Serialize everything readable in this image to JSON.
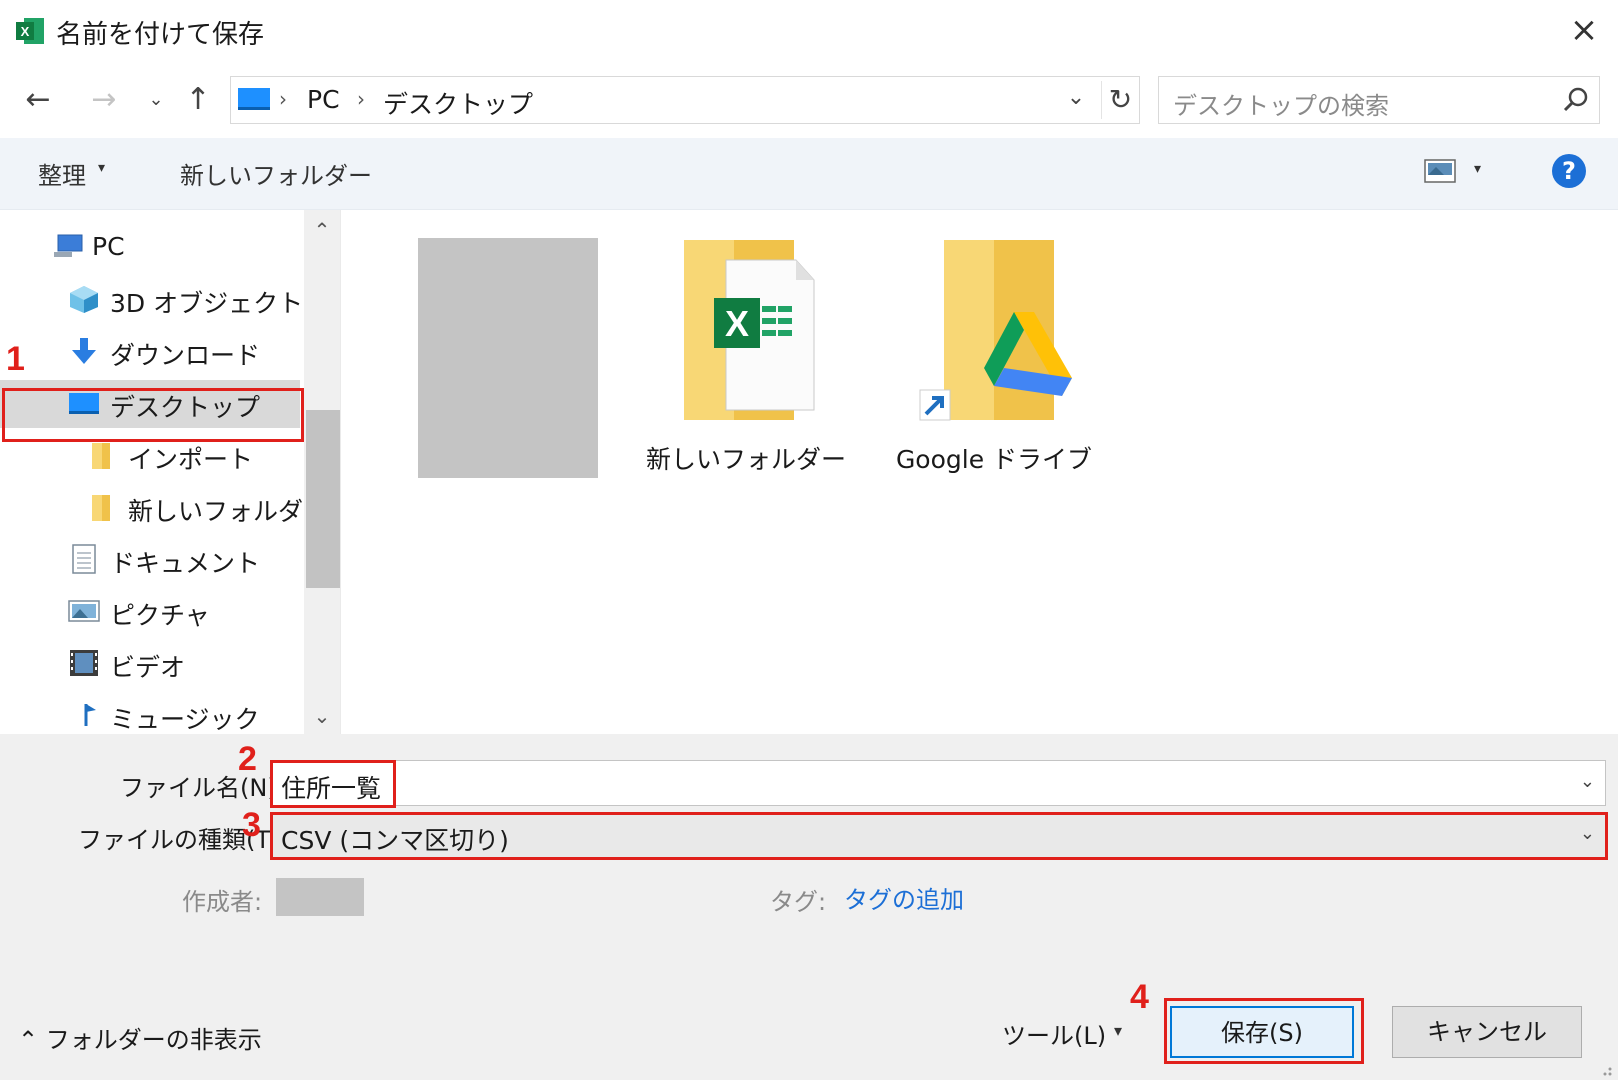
{
  "window": {
    "title": "名前を付けて保存",
    "close_icon": "×"
  },
  "nav": {
    "back_icon": "←",
    "forward_icon": "→",
    "recent_icon": "⌄",
    "up_icon": "↑",
    "address": {
      "segments": [
        "PC",
        "デスクトップ"
      ],
      "separator": "›",
      "dropdown_icon": "⌄",
      "refresh_icon": "↻"
    },
    "search": {
      "placeholder": "デスクトップの検索"
    }
  },
  "toolbar": {
    "organize_label": "整理",
    "new_folder_label": "新しいフォルダー",
    "caret": "▾",
    "help_label": "?"
  },
  "nav_pane": {
    "items": [
      {
        "label": "PC",
        "icon": "pc-icon"
      },
      {
        "label": "3D オブジェクト",
        "icon": "3d-objects-icon"
      },
      {
        "label": "ダウンロード",
        "icon": "download-icon"
      },
      {
        "label": "デスクトップ",
        "icon": "desktop-icon",
        "selected": true
      },
      {
        "label": "インポート",
        "icon": "folder-icon"
      },
      {
        "label": "新しいフォルダー",
        "icon": "folder-icon"
      },
      {
        "label": "ドキュメント",
        "icon": "documents-icon"
      },
      {
        "label": "ピクチャ",
        "icon": "pictures-icon"
      },
      {
        "label": "ビデオ",
        "icon": "video-icon"
      },
      {
        "label": "ミュージック",
        "icon": "music-icon"
      }
    ],
    "scroll_up": "⌃",
    "scroll_down": "⌄"
  },
  "content": {
    "items": [
      {
        "label": "新しいフォルダー",
        "icon": "excel-folder-icon"
      },
      {
        "label": "Google ドライブ",
        "icon": "google-drive-folder-icon"
      }
    ]
  },
  "form": {
    "filename_label": "ファイル名(N):",
    "filename_value": "住所一覧",
    "filetype_label": "ファイルの種類(T):",
    "filetype_value": "CSV (コンマ区切り)",
    "author_label": "作成者:",
    "tags_label": "タグ:",
    "tags_link": "タグの追加",
    "hide_folders_label": "フォルダーの非表示",
    "tools_label": "ツール(L)",
    "save_label": "保存(S)",
    "cancel_label": "キャンセル"
  },
  "annotations": {
    "step1": "1",
    "step2": "2",
    "step3": "3",
    "step4": "4",
    "color": "#e0201b"
  },
  "colors": {
    "accent": "#1c6fd6",
    "selection": "#d9d9d9",
    "toolbar_bg": "#f0f4f9",
    "bottom_bg": "#f0f0f0"
  }
}
